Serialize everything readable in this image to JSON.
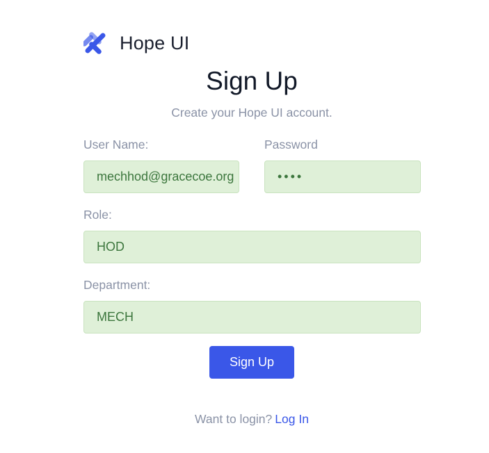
{
  "brand": {
    "name": "Hope UI",
    "logo_icon": "hope-ui-logo-icon",
    "logo_color": "#3a57e8"
  },
  "heading": {
    "title": "Sign Up",
    "subtitle": "Create your Hope UI account."
  },
  "form": {
    "username": {
      "label": "User Name:",
      "value": "mechhod@gracecoe.org"
    },
    "password": {
      "label": "Password",
      "value": "••••"
    },
    "role": {
      "label": "Role:",
      "value": "HOD"
    },
    "department": {
      "label": "Department:",
      "value": "MECH"
    },
    "submit_label": "Sign Up"
  },
  "footer": {
    "prompt": "Want to login?",
    "link_label": "Log In"
  },
  "colors": {
    "accent": "#3a57e8",
    "field_background": "#dff0d8",
    "field_text": "#3c763d",
    "muted_text": "#8a92a6"
  }
}
